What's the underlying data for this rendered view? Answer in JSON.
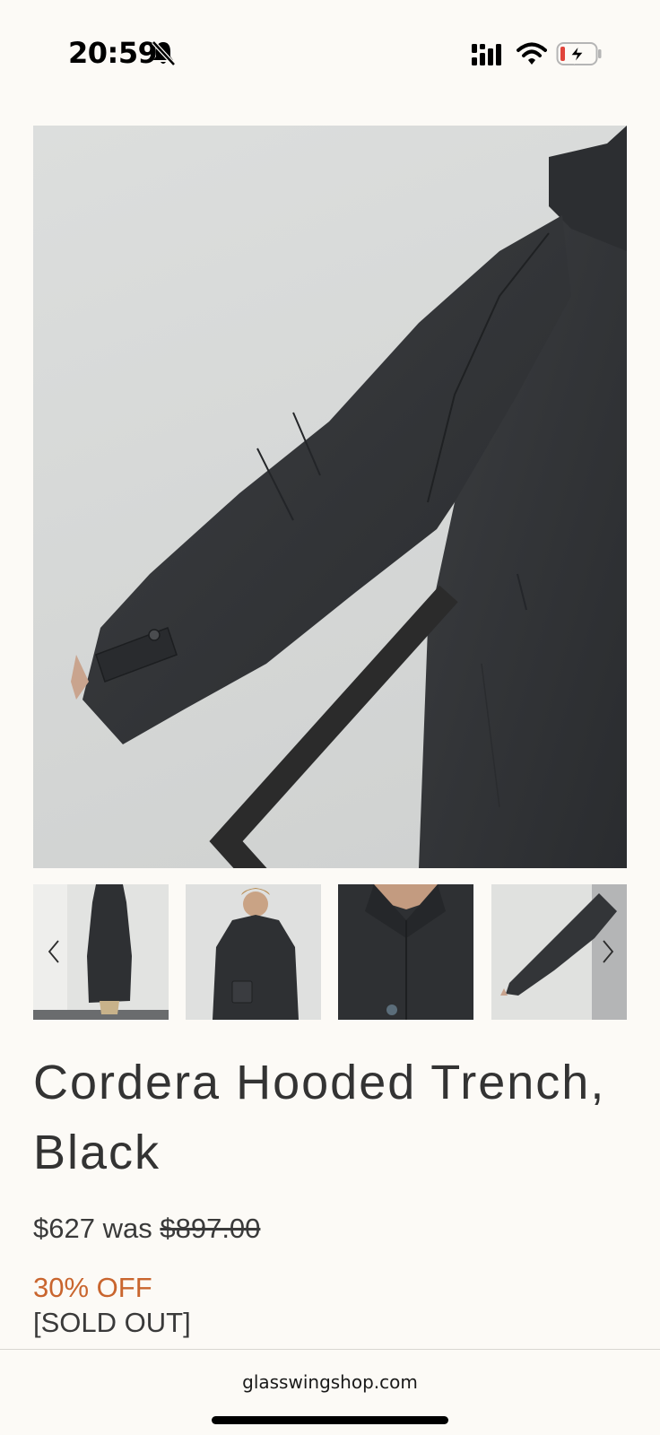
{
  "status_bar": {
    "time": "20:59",
    "icons": [
      "bell-slash-icon",
      "signal-icon",
      "wifi-icon",
      "battery-charging-icon"
    ],
    "battery_color": "#e0443a"
  },
  "gallery": {
    "main_image": "coat-sleeve-photo",
    "thumbnails": [
      "coat-side-view",
      "model-front-view",
      "collar-detail",
      "sleeve-detail"
    ],
    "prev_icon": "chevron-left-icon",
    "next_icon": "chevron-right-icon"
  },
  "product": {
    "title": "Cordera Hooded Trench, Black",
    "price": "$627",
    "was_label": "was",
    "old_price": "$897.00",
    "discount": "30% OFF",
    "availability": "[SOLD OUT]",
    "discount_color": "#c9652e"
  },
  "browser": {
    "url": "glasswingshop.com"
  }
}
